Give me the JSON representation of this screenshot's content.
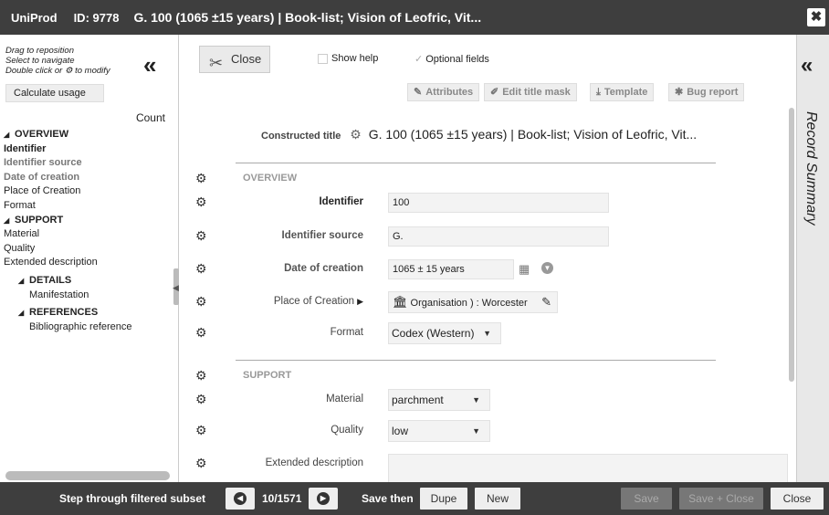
{
  "window": {
    "app_name": "UniProd",
    "record_id": "ID: 9778",
    "title": "G. 100 (1065 ±15 years) | Book-list; Vision of Leofric, Vit...",
    "close_glyph": "✖"
  },
  "sidebar": {
    "hint_line1": "Drag to reposition",
    "hint_line2": "Select to navigate",
    "hint_line3_a": "Double click or",
    "hint_line3_b": "to modify",
    "collapse_glyph": "«",
    "calculate_label": "Calculate usage",
    "count_label": "Count",
    "items": [
      {
        "label": "OVERVIEW",
        "kind": "section"
      },
      {
        "label": "Identifier",
        "kind": "bold"
      },
      {
        "label": "Identifier source",
        "kind": "gray"
      },
      {
        "label": "Date of creation",
        "kind": "gray"
      },
      {
        "label": "Place of Creation",
        "kind": "plain"
      },
      {
        "label": "Format",
        "kind": "plain"
      },
      {
        "label": "SUPPORT",
        "kind": "section"
      },
      {
        "label": "Material",
        "kind": "plain"
      },
      {
        "label": "Quality",
        "kind": "plain"
      },
      {
        "label": "Extended description",
        "kind": "plain"
      },
      {
        "label": "DETAILS",
        "kind": "subsection"
      },
      {
        "label": "Manifestation",
        "kind": "subitem"
      },
      {
        "label": "REFERENCES",
        "kind": "subsection"
      },
      {
        "label": "Bibliographic reference",
        "kind": "subitem"
      }
    ]
  },
  "toolbar": {
    "close_label": "Close",
    "show_help_label": "Show help",
    "optional_fields_label": "Optional fields",
    "attributes_label": "Attributes",
    "edit_title_mask_label": "Edit title mask",
    "template_label": "Template",
    "bug_report_label": "Bug report"
  },
  "form": {
    "constructed_title_label": "Constructed title",
    "constructed_title_value": "G. 100 (1065 ±15 years) | Book-list; Vision of Leofric, Vit...",
    "overview_heading": "OVERVIEW",
    "support_heading": "SUPPORT",
    "identifier_label": "Identifier",
    "identifier_value": "100",
    "identifier_source_label": "Identifier source",
    "identifier_source_value": "G.",
    "date_label": "Date of creation",
    "date_value": "1065 ± 15 years",
    "place_label": "Place of Creation",
    "place_value": "Organisation ) : Worcester",
    "format_label": "Format",
    "format_value": "Codex (Western)",
    "material_label": "Material",
    "material_value": "parchment",
    "quality_label": "Quality",
    "quality_value": "low",
    "extended_label": "Extended description",
    "extended_value": ""
  },
  "right_panel": {
    "collapse_glyph": "«",
    "label": "Record Summary"
  },
  "bottom": {
    "step_label": "Step through filtered subset",
    "counter": "10/1571",
    "save_then_label": "Save then",
    "dupe_label": "Dupe",
    "new_label": "New",
    "save_label": "Save",
    "save_close_label": "Save + Close",
    "close_label": "Close"
  }
}
